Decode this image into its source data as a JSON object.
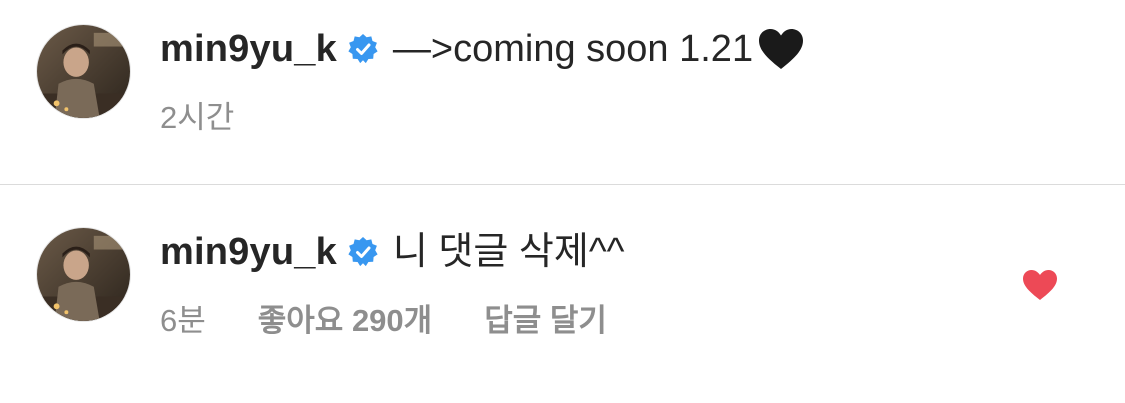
{
  "caption": {
    "username": "min9yu_k",
    "verified_icon": "verified-badge-icon",
    "text": "—>coming soon 1.21",
    "emoji_icon": "black-heart-emoji-icon",
    "time": "2시간"
  },
  "comment": {
    "username": "min9yu_k",
    "verified_icon": "verified-badge-icon",
    "text": "니 댓글 삭제^^",
    "time": "6분",
    "likes_label": "좋아요 290개",
    "reply_label": "답글 달기",
    "like_icon": "heart-filled-icon"
  },
  "colors": {
    "verified_blue": "#3897f0",
    "like_red": "#ed4956",
    "meta_gray": "#8e8e8e",
    "divider": "#dbdbdb"
  }
}
